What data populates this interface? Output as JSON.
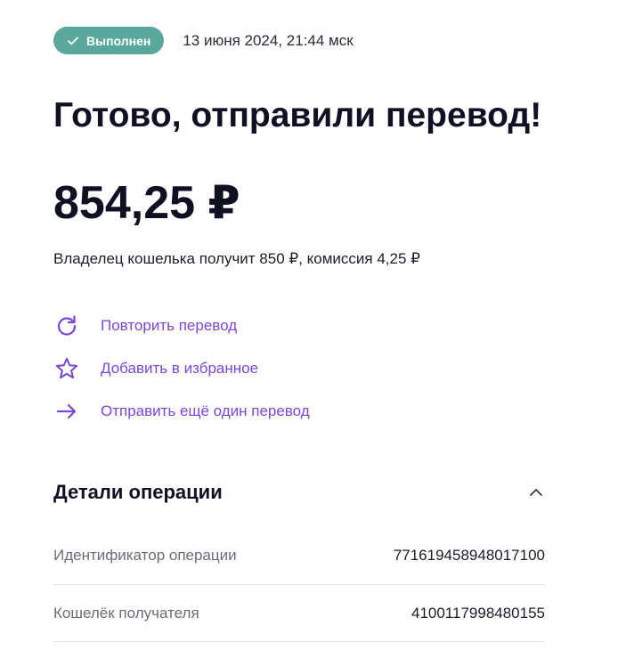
{
  "status": {
    "badge_label": "Выполнен",
    "date": "13 июня 2024, 21:44 мск"
  },
  "title": "Готово, отправили перевод!",
  "amount": "854,25 ₽",
  "subline": "Владелец кошелька получит 850 ₽, комиссия 4,25 ₽",
  "actions": [
    {
      "label": "Повторить перевод",
      "icon": "repeat-icon"
    },
    {
      "label": "Добавить в избранное",
      "icon": "star-icon"
    },
    {
      "label": "Отправить ещё один перевод",
      "icon": "arrow-right-icon"
    }
  ],
  "details": {
    "title": "Детали операции",
    "rows": [
      {
        "key": "Идентификатор операции",
        "value": "771619458948017100"
      },
      {
        "key": "Кошелёк получателя",
        "value": "4100117998480155"
      }
    ]
  },
  "colors": {
    "badge": "#5aa89b",
    "accent": "#7a47d6",
    "text": "#0f1021",
    "muted": "#6b6c78"
  }
}
